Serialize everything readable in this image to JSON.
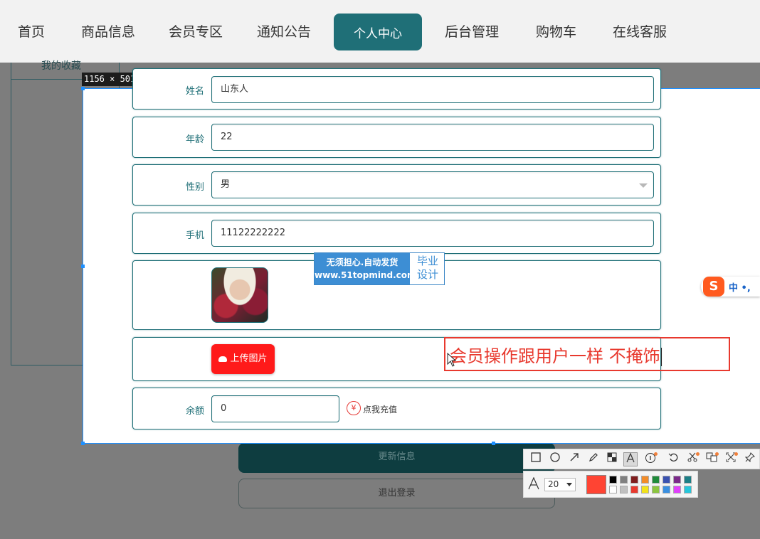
{
  "nav": {
    "items": [
      "首页",
      "商品信息",
      "会员专区",
      "通知公告",
      "个人中心",
      "后台管理",
      "购物车",
      "在线客服"
    ],
    "active_index": 4
  },
  "background": {
    "partial_text": "我的收藏",
    "update_button": "更新信息",
    "logout_button": "退出登录"
  },
  "capture": {
    "size_label": "1156 × 501"
  },
  "form": {
    "name_label": "姓名",
    "name_value": "山东人",
    "age_label": "年龄",
    "age_value": "22",
    "gender_label": "性别",
    "gender_value": "男",
    "phone_label": "手机",
    "phone_value": "11122222222",
    "upload_label": "上传图片",
    "balance_label": "余额",
    "balance_value": "0",
    "recharge_label": "点我充值",
    "yen_symbol": "¥"
  },
  "watermark": {
    "line1": "无须担心.自动发货",
    "line2": "www.51topmind.com",
    "right_line1": "毕业",
    "right_line2": "设计"
  },
  "annotation": {
    "text": "会员操作跟用户一样  不掩饰"
  },
  "ime": {
    "logo": "S",
    "text": "中 •,"
  },
  "snip_toolbar": {
    "font_size": "20",
    "current_color": "#ff4433",
    "palette_top": [
      "#000000",
      "#808080",
      "#7f1d1d",
      "#f28c28",
      "#1f8a3a",
      "#3a52b0",
      "#7b2a8a",
      "#1c7f86"
    ],
    "palette_bottom": [
      "#ffffff",
      "#c0c0c0",
      "#e8392e",
      "#f2e21a",
      "#8bc53f",
      "#3a8fe0",
      "#e040fb",
      "#26c6da"
    ]
  },
  "colors": {
    "accent": "#1f6f77",
    "annotation": "#e8392e",
    "upload_button": "#ff1a1a"
  }
}
